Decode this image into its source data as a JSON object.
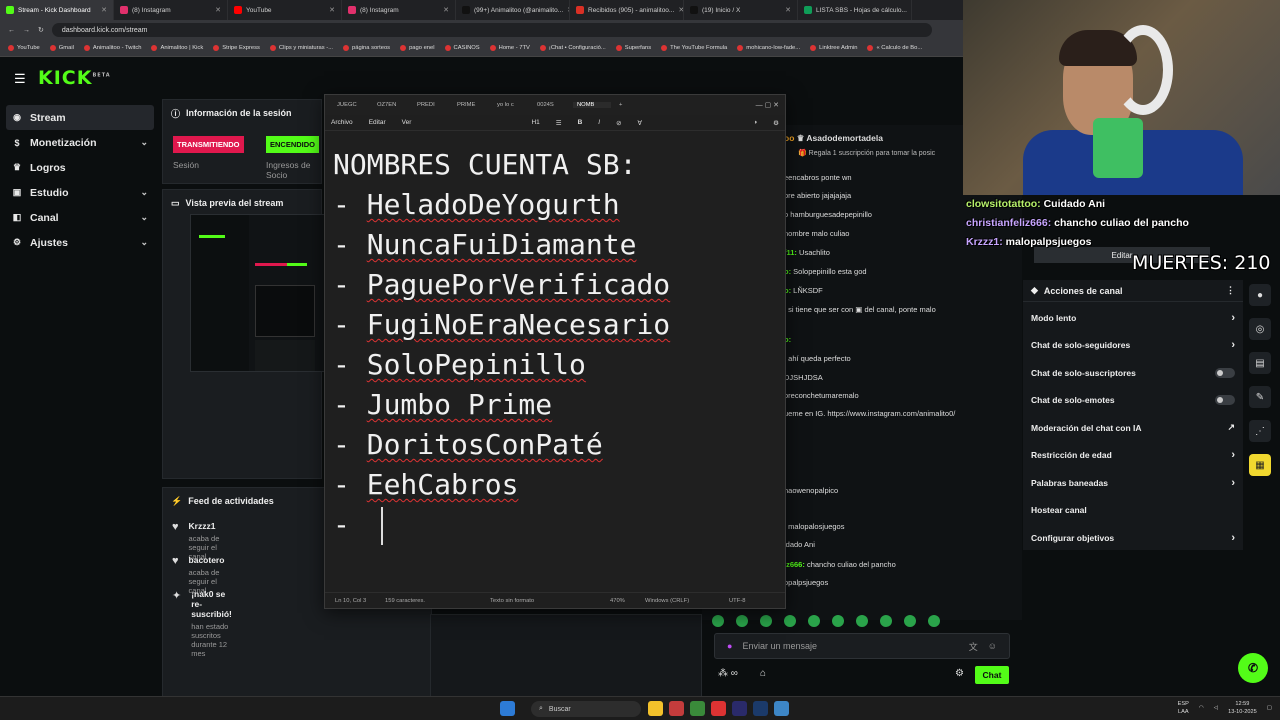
{
  "browser": {
    "tabs": [
      {
        "label": "Stream - Kick Dashboard",
        "color": "#53fc18"
      },
      {
        "label": "(8) Instagram",
        "color": "#e1306c"
      },
      {
        "label": "YouTube",
        "color": "#ff0000"
      },
      {
        "label": "(8) Instagram",
        "color": "#e1306c"
      },
      {
        "label": "(99+) Animalitoo (@animalito...",
        "color": "#111111"
      },
      {
        "label": "Recibidos (905) - animalitoo...",
        "color": "#d93025"
      },
      {
        "label": "(19) Inicio / X",
        "color": "#111111"
      },
      {
        "label": "LISTA SBS - Hojas de cálculo...",
        "color": "#0f9d58"
      }
    ],
    "url": "dashboard.kick.com/stream",
    "bookmarks": [
      "YouTube",
      "Gmail",
      "Animalitoo - Twitch",
      "Animalitoo | Kick",
      "Stripe Express",
      "Clips y miniaturas -...",
      "página sorteos",
      "pago enel",
      "CASINOS",
      "Home - 7TV",
      "¡Chat • Configuració...",
      "Superfans",
      "The YouTube Formula",
      "mohicano-low-fade...",
      "Linktree Admin",
      "« Calculo de Bo..."
    ]
  },
  "kick": {
    "logo": "KICK",
    "logo_beta": "BETA",
    "sidebar": [
      {
        "label": "Stream",
        "icon": "broadcast-icon",
        "glyph": "◉",
        "chev": ""
      },
      {
        "label": "Monetización",
        "icon": "dollar-icon",
        "glyph": "$",
        "chev": "⌄"
      },
      {
        "label": "Logros",
        "icon": "trophy-icon",
        "glyph": "♛",
        "chev": ""
      },
      {
        "label": "Estudio",
        "icon": "studio-icon",
        "glyph": "▣",
        "chev": "⌄"
      },
      {
        "label": "Canal",
        "icon": "channel-icon",
        "glyph": "◧",
        "chev": "⌄"
      },
      {
        "label": "Ajustes",
        "icon": "gear-icon",
        "glyph": "⚙",
        "chev": "⌄"
      }
    ],
    "session": {
      "title": "Información de la sesión",
      "live_badge": "TRANSMITIENDO",
      "on_badge": "ENCENDIDO",
      "session_label": "Sesión",
      "income_label": "Ingresos de Socio"
    },
    "preview_title": "Vista previa del stream",
    "feed": {
      "title": "Feed de actividades",
      "items": [
        {
          "name": "Krzzz1",
          "desc": "acaba de seguir el canal",
          "glyph": "♥"
        },
        {
          "name": "bacotero",
          "desc": "acaba de seguir el canal",
          "glyph": "♥"
        },
        {
          "name": "¡nak0 se re-suscribió!",
          "desc": "han estado suscritos durante 12 mes",
          "glyph": "✦"
        }
      ]
    },
    "chat": {
      "header_user": "Asadodemortadela",
      "header_sub": "Regala 1 suscripción para tomar la posic",
      "lines": [
        {
          "user": "",
          "text": "eencabros ponte wn"
        },
        {
          "user": "",
          "text": "bre abierto jajajajaja"
        },
        {
          "user": "",
          "text": "o hamburguesadepepinillo"
        },
        {
          "user": "",
          "text": "nombre malo culiao"
        },
        {
          "user": "f11:",
          "text": " Usachlito"
        },
        {
          "user": "o:",
          "text": " Solopepinillo esta god"
        },
        {
          "user": "o:",
          "text": " LÑKSDF"
        },
        {
          "user": "",
          "text": ": si tiene que ser con ▣ del canal, ponte malo"
        },
        {
          "user": "o:",
          "text": ""
        },
        {
          "user": "",
          "text": ": ahí queda perfecto"
        },
        {
          "user": "",
          "text": " DJSHJDSA"
        },
        {
          "user": "",
          "text": "oreconchetumaremalo"
        },
        {
          "user": "",
          "text": "ueme en IG. https://www.instagram.com/animalito0/"
        },
        {
          "user": "",
          "text": "haowenopalpico"
        },
        {
          "user": "",
          "text": ": malopalosjuegos"
        },
        {
          "user": "",
          "text": "idado Ani"
        },
        {
          "user": "iz666:",
          "text": " chancho culiao del pancho"
        },
        {
          "user": "",
          "text": "opalpsjuegos"
        }
      ],
      "input_placeholder": "Enviar un mensaje",
      "send_label": "Chat"
    },
    "actions": {
      "title": "Acciones de canal",
      "edit_label": "Editar",
      "rows": [
        {
          "label": "Modo lento",
          "control": "chevron"
        },
        {
          "label": "Chat de solo-seguidores",
          "control": "chevron"
        },
        {
          "label": "Chat de solo-suscriptores",
          "control": "toggle"
        },
        {
          "label": "Chat de solo-emotes",
          "control": "toggle"
        },
        {
          "label": "Moderación del chat con IA",
          "control": "external"
        },
        {
          "label": "Restricción de edad",
          "control": "chevron"
        },
        {
          "label": "Palabras baneadas",
          "control": "chevron"
        },
        {
          "label": "Hostear canal",
          "control": "none"
        },
        {
          "label": "Configurar objetivos",
          "control": "chevron"
        }
      ]
    }
  },
  "notepad": {
    "tabs": [
      "JUEGC",
      "OZ7EN",
      "PREDI",
      "PRIME",
      "yo lo c",
      "0024S",
      "NOMB"
    ],
    "menu": [
      "Archivo",
      "Editar",
      "Ver"
    ],
    "heading_dropdown": "H1",
    "title_line": "NOMBRES CUENTA SB:",
    "names": [
      "HeladoDeYogurth",
      "NuncaFuiDiamante",
      "PaguePorVerificado",
      "FugiNoEraNecesario",
      "SoloPepinillo",
      "Jumbo Prime",
      "DoritosConPaté",
      "EehCabros"
    ],
    "bullet": "- ",
    "status": {
      "position": "Ln 10, Col 3",
      "chars": "159 caracteres.",
      "format": "Texto sin formato",
      "zoom": "470%",
      "eol": "Windows (CRLF)",
      "encoding": "UTF-8"
    }
  },
  "overlay": {
    "chat": [
      {
        "user": "clowsitotattoo:",
        "text": " Cuidado Ani"
      },
      {
        "user": "christianfeliz666:",
        "text": " chancho culiao del pancho"
      },
      {
        "user": "Krzzz1:",
        "text": " malopalpsjuegos"
      }
    ],
    "deaths_label": "MUERTES: 210"
  },
  "taskbar": {
    "search_placeholder": "Buscar",
    "lang": "ESP",
    "lang2": "LAA",
    "time": "12:59",
    "date": "13-10-2025"
  }
}
